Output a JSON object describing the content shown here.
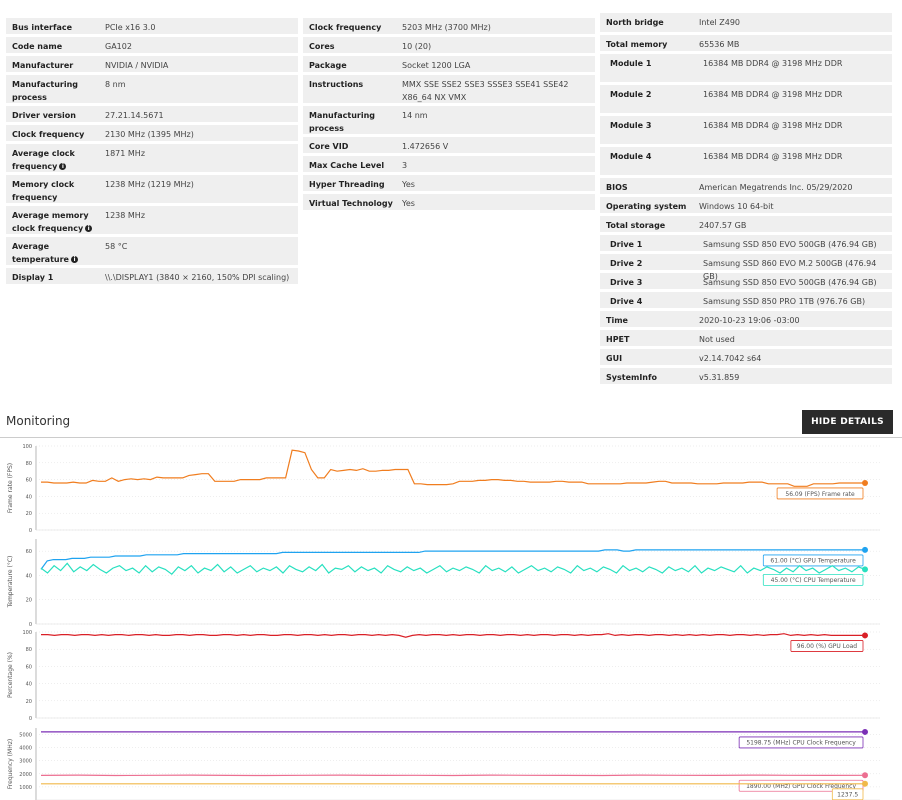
{
  "gpu": {
    "rows": [
      {
        "key": "Bus interface",
        "value": "PCIe x16 3.0",
        "info": false
      },
      {
        "key": "Code name",
        "value": "GA102",
        "info": false
      },
      {
        "key": "Manufacturer",
        "value": "NVIDIA / NVIDIA",
        "info": false
      },
      {
        "key": "Manufacturing process",
        "value": "8 nm",
        "info": false
      },
      {
        "key": "Driver version",
        "value": "27.21.14.5671",
        "info": false
      },
      {
        "key": "Clock frequency",
        "value": "2130 MHz (1395 MHz)",
        "info": false
      },
      {
        "key": "Average clock frequency",
        "value": "1871 MHz",
        "info": true
      },
      {
        "key": "Memory clock frequency",
        "value": "1238 MHz (1219 MHz)",
        "info": false
      },
      {
        "key": "Average memory clock frequency",
        "value": "1238 MHz",
        "info": true
      },
      {
        "key": "Average temperature",
        "value": "58 °C",
        "info": true
      },
      {
        "key": "Display 1",
        "value": "\\\\.\\DISPLAY1 (3840 × 2160, 150% DPI scaling)",
        "info": false
      }
    ]
  },
  "cpu": {
    "rows": [
      {
        "key": "Clock frequency",
        "value": "5203 MHz (3700 MHz)"
      },
      {
        "key": "Cores",
        "value": "10 (20)"
      },
      {
        "key": "Package",
        "value": "Socket 1200 LGA"
      },
      {
        "key": "Instructions",
        "value": "MMX SSE SSE2 SSE3 SSSE3 SSE41 SSE42 X86_64 NX VMX"
      },
      {
        "key": "Manufacturing process",
        "value": "14 nm"
      },
      {
        "key": "Core VID",
        "value": "1.472656 V"
      },
      {
        "key": "Max Cache Level",
        "value": "3"
      },
      {
        "key": "Hyper Threading",
        "value": "Yes"
      },
      {
        "key": "Virtual Technology",
        "value": "Yes"
      }
    ]
  },
  "system": {
    "rows": [
      {
        "key": "North bridge",
        "value": "Intel Z490",
        "indent": false
      },
      {
        "key": "Total memory",
        "value": "65536 MB",
        "indent": false
      },
      {
        "key": "Module 1",
        "value": "16384 MB DDR4 @ 3198 MHz DDR",
        "indent": true
      },
      {
        "key": "Module 2",
        "value": "16384 MB DDR4 @ 3198 MHz DDR",
        "indent": true
      },
      {
        "key": "Module 3",
        "value": "16384 MB DDR4 @ 3198 MHz DDR",
        "indent": true
      },
      {
        "key": "Module 4",
        "value": "16384 MB DDR4 @ 3198 MHz DDR",
        "indent": true
      },
      {
        "key": "BIOS",
        "value": "American Megatrends Inc. 05/29/2020",
        "indent": false
      },
      {
        "key": "Operating system",
        "value": "Windows 10 64-bit",
        "indent": false
      },
      {
        "key": "Total storage",
        "value": "2407.57 GB",
        "indent": false
      },
      {
        "key": "Drive 1",
        "value": "Samsung SSD 850 EVO 500GB (476.94 GB)",
        "indent": true
      },
      {
        "key": "Drive 2",
        "value": "Samsung SSD 860 EVO M.2 500GB (476.94 GB)",
        "indent": true
      },
      {
        "key": "Drive 3",
        "value": "Samsung SSD 850 EVO 500GB (476.94 GB)",
        "indent": true
      },
      {
        "key": "Drive 4",
        "value": "Samsung SSD 850 PRO 1TB (976.76 GB)",
        "indent": true
      },
      {
        "key": "Time",
        "value": "2020-10-23 19:06 -03:00",
        "indent": false
      },
      {
        "key": "HPET",
        "value": "Not used",
        "indent": false
      },
      {
        "key": "GUI",
        "value": "v2.14.7042 s64",
        "indent": false
      },
      {
        "key": "SystemInfo",
        "value": "v5.31.859",
        "indent": false
      }
    ]
  },
  "monitoring": {
    "title": "Monitoring",
    "hide_details_label": "HIDE DETAILS"
  },
  "chart_data": [
    {
      "type": "line",
      "ylabel": "Frame rate (FPS)",
      "ylim": [
        0,
        100
      ],
      "yticks": [
        0,
        20,
        40,
        60,
        80,
        100
      ],
      "series": [
        {
          "name": "(FPS) Frame rate",
          "color": "#f07d1f",
          "last_label": "56.09 (FPS) Frame rate",
          "values": [
            57,
            57,
            56,
            56,
            56,
            57,
            56,
            56,
            59,
            58,
            58,
            62,
            58,
            60,
            61,
            60,
            61,
            60,
            63,
            62,
            62,
            62,
            62,
            65,
            66,
            67,
            67,
            58,
            58,
            58,
            58,
            60,
            60,
            60,
            60,
            62,
            62,
            62,
            62,
            95,
            94,
            92,
            72,
            62,
            62,
            72,
            70,
            71,
            72,
            71,
            73,
            70,
            70,
            71,
            71,
            72,
            72,
            72,
            55,
            55,
            54,
            54,
            54,
            54,
            55,
            58,
            58,
            58,
            59,
            59,
            60,
            60,
            59,
            59,
            58,
            58,
            57,
            57,
            57,
            57,
            58,
            58,
            57,
            57,
            57,
            55,
            55,
            55,
            55,
            55,
            55,
            56,
            56,
            56,
            56,
            57,
            58,
            58,
            56,
            56,
            56,
            56,
            55,
            55,
            55,
            55,
            56,
            56,
            56,
            56,
            57,
            57,
            57,
            55,
            55,
            55,
            55,
            52,
            52,
            52,
            55,
            55,
            55,
            55,
            56,
            56,
            56,
            56,
            56
          ]
        }
      ]
    },
    {
      "type": "line",
      "ylabel": "Temperature (°C)",
      "ylim": [
        0,
        70
      ],
      "yticks": [
        0,
        20,
        40,
        60
      ],
      "series": [
        {
          "name": "(°C) GPU Temperature",
          "color": "#1fa3f0",
          "last_label": "61.00 (°C) GPU Temperature",
          "values": [
            45,
            52,
            53,
            53,
            53,
            54,
            54,
            54,
            55,
            55,
            55,
            55,
            56,
            56,
            56,
            56,
            56,
            57,
            57,
            57,
            57,
            57,
            57,
            58,
            58,
            58,
            58,
            58,
            58,
            58,
            58,
            58,
            58,
            58,
            58,
            58,
            58,
            58,
            58,
            59,
            59,
            59,
            59,
            59,
            59,
            59,
            59,
            59,
            59,
            59,
            59,
            59,
            59,
            59,
            59,
            59,
            59,
            59,
            59,
            59,
            59,
            59,
            60,
            60,
            60,
            60,
            60,
            60,
            60,
            60,
            60,
            60,
            60,
            60,
            60,
            60,
            60,
            60,
            60,
            60,
            60,
            60,
            60,
            60,
            60,
            60,
            60,
            60,
            60,
            60,
            60,
            61,
            61,
            61,
            60,
            60,
            61,
            61,
            61,
            61,
            61,
            61,
            61,
            61,
            61,
            61,
            61,
            61,
            61,
            61,
            61,
            61,
            61,
            61,
            61,
            61,
            61,
            61,
            61,
            61,
            61,
            61,
            61,
            61,
            61,
            61,
            61,
            61,
            61,
            61,
            61,
            61,
            61,
            61
          ]
        },
        {
          "name": "(°C) CPU Temperature",
          "color": "#28e0c0",
          "last_label": "45.00 (°C) CPU Temperature",
          "values": [
            46,
            42,
            48,
            44,
            50,
            43,
            47,
            44,
            49,
            45,
            42,
            46,
            48,
            44,
            46,
            42,
            48,
            43,
            47,
            45,
            41,
            47,
            44,
            48,
            42,
            46,
            44,
            49,
            43,
            47,
            42,
            45,
            48,
            43,
            46,
            44,
            47,
            42,
            48,
            45,
            43,
            47,
            44,
            49,
            42,
            46,
            45,
            48,
            43,
            47,
            44,
            46,
            42,
            48,
            45,
            43,
            47,
            44,
            46,
            42,
            45,
            48,
            43,
            46,
            44,
            47,
            45,
            42,
            48,
            44,
            46,
            43,
            47,
            42,
            45,
            48,
            44,
            46,
            43,
            47,
            45,
            42,
            48,
            44,
            46,
            43,
            47,
            45,
            42,
            48,
            44,
            46,
            43,
            47,
            45,
            42,
            47,
            44,
            46,
            43,
            48,
            42,
            46,
            44,
            47,
            45,
            43,
            48,
            42,
            46,
            44,
            47,
            45,
            42,
            46,
            43,
            48,
            44,
            46,
            42,
            45,
            48,
            44,
            46,
            43,
            47,
            45
          ]
        }
      ]
    },
    {
      "type": "line",
      "ylabel": "Percentage (%)",
      "ylim": [
        0,
        100
      ],
      "yticks": [
        0,
        20,
        40,
        60,
        80,
        100
      ],
      "series": [
        {
          "name": "(%) GPU Load",
          "color": "#d91f26",
          "last_label": "96.00 (%) GPU Load",
          "values": [
            97,
            97,
            96,
            97,
            97,
            96,
            97,
            97,
            96,
            97,
            96,
            97,
            97,
            96,
            97,
            97,
            96,
            97,
            96,
            96,
            97,
            97,
            96,
            97,
            97,
            96,
            96,
            97,
            97,
            96,
            97,
            96,
            97,
            97,
            96,
            96,
            97,
            97,
            96,
            97,
            97,
            96,
            97,
            96,
            97,
            97,
            96,
            97,
            97,
            96,
            97,
            96,
            97,
            96,
            94,
            96,
            97,
            96,
            97,
            97,
            96,
            97,
            96,
            97,
            97,
            96,
            97,
            97,
            96,
            97,
            97,
            96,
            97,
            96,
            97,
            97,
            96,
            97,
            97,
            96,
            97,
            96,
            97,
            97,
            98,
            96,
            97,
            96,
            97,
            97,
            96,
            97,
            97,
            96,
            97,
            96,
            97,
            96,
            97,
            96,
            97,
            97,
            96,
            97,
            97,
            96,
            97,
            96,
            97,
            97,
            98,
            96,
            97,
            96,
            97,
            96,
            97,
            96,
            96,
            96,
            96,
            96,
            96
          ]
        }
      ]
    },
    {
      "type": "line",
      "ylabel": "Frequency (MHz)",
      "ylim": [
        0,
        5500
      ],
      "yticks": [
        1000,
        2000,
        3000,
        4000,
        5000
      ],
      "series": [
        {
          "name": "(MHz) CPU Clock Frequency",
          "color": "#7b2fb5",
          "last_label": "5198.75 (MHz) CPU Clock Frequency",
          "values": [
            5200,
            5200,
            5200,
            5200,
            5200,
            5200,
            5200,
            5200,
            5200,
            5200,
            5200,
            5200,
            5200,
            5200,
            5200,
            5200,
            5200,
            5200,
            5200,
            5200,
            5199,
            5199,
            5199
          ]
        },
        {
          "name": "(MHz) GPU Clock Frequency",
          "color": "#ec6f91",
          "last_label": "1890.00 (MHz) GPU Clock Frequency",
          "values": [
            1880,
            1900,
            1870,
            1890,
            1900,
            1880,
            1870,
            1890,
            1900,
            1880,
            1890,
            1870,
            1900,
            1890,
            1880,
            1870,
            1900,
            1890,
            1880,
            1900,
            1890,
            1880,
            1890
          ]
        },
        {
          "name": "memory clock",
          "color": "#f0b94a",
          "last_label": "1237.5",
          "values": [
            1238,
            1238,
            1238,
            1238,
            1238,
            1238,
            1238,
            1238,
            1238,
            1238,
            1238,
            1238,
            1238,
            1238,
            1238,
            1238,
            1238,
            1238,
            1238,
            1238,
            1238,
            1238,
            1238
          ]
        }
      ]
    }
  ]
}
